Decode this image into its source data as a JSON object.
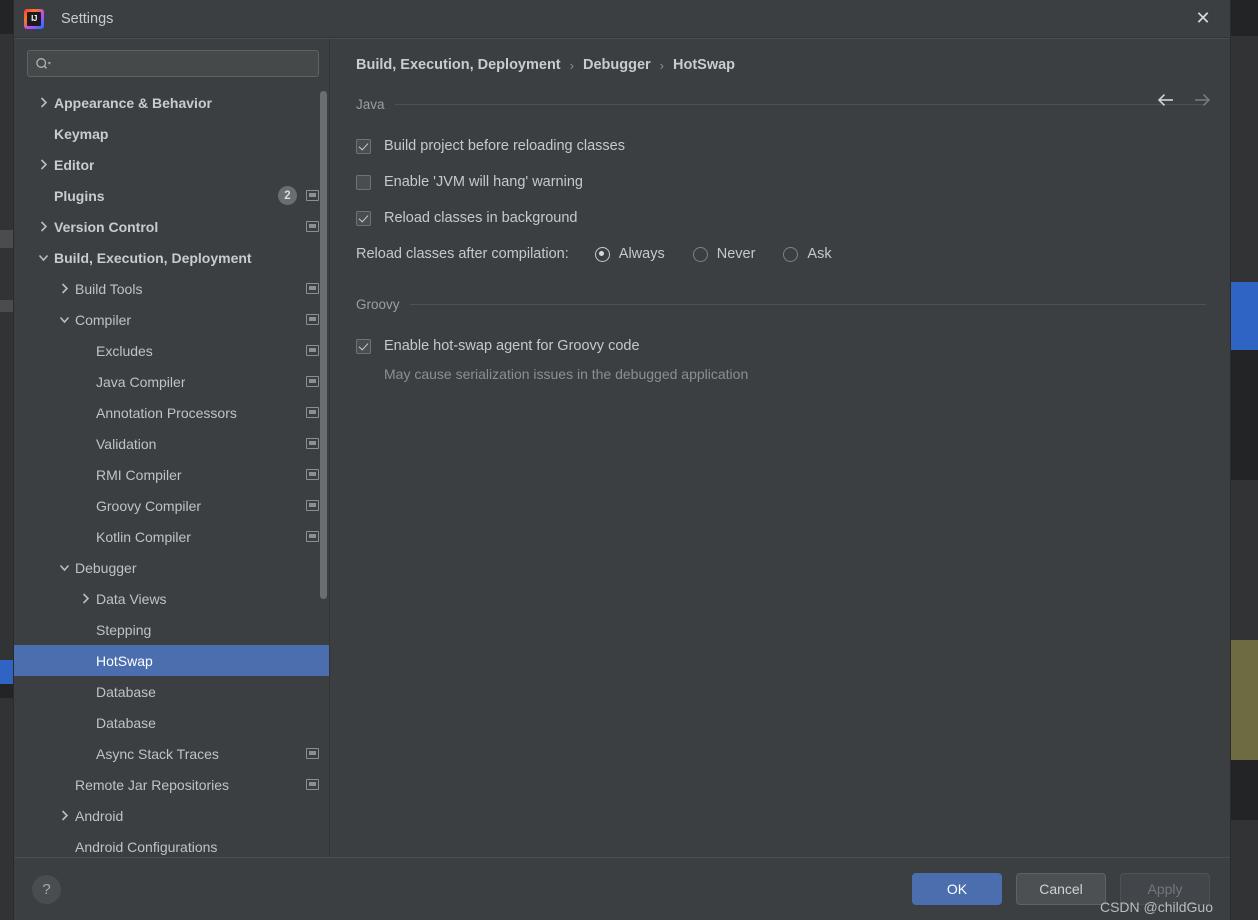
{
  "window": {
    "title": "Settings",
    "logo_icon": "intellij-idea-logo",
    "close_icon": "close-icon"
  },
  "search": {
    "placeholder": "",
    "value": "",
    "icon": "search-icon"
  },
  "sidebar": {
    "items": [
      {
        "label": "Appearance & Behavior",
        "twisty": "collapsed",
        "indent": 0,
        "bold": true,
        "badge": null,
        "project_icon": false,
        "selected": false
      },
      {
        "label": "Keymap",
        "twisty": "none",
        "indent": 0,
        "bold": true,
        "badge": null,
        "project_icon": false,
        "selected": false
      },
      {
        "label": "Editor",
        "twisty": "collapsed",
        "indent": 0,
        "bold": true,
        "badge": null,
        "project_icon": false,
        "selected": false
      },
      {
        "label": "Plugins",
        "twisty": "none",
        "indent": 0,
        "bold": true,
        "badge": "2",
        "project_icon": true,
        "selected": false
      },
      {
        "label": "Version Control",
        "twisty": "collapsed",
        "indent": 0,
        "bold": true,
        "badge": null,
        "project_icon": true,
        "selected": false
      },
      {
        "label": "Build, Execution, Deployment",
        "twisty": "expanded",
        "indent": 0,
        "bold": true,
        "badge": null,
        "project_icon": false,
        "selected": false
      },
      {
        "label": "Build Tools",
        "twisty": "collapsed",
        "indent": 1,
        "bold": false,
        "badge": null,
        "project_icon": true,
        "selected": false
      },
      {
        "label": "Compiler",
        "twisty": "expanded",
        "indent": 1,
        "bold": false,
        "badge": null,
        "project_icon": true,
        "selected": false
      },
      {
        "label": "Excludes",
        "twisty": "none",
        "indent": 2,
        "bold": false,
        "badge": null,
        "project_icon": true,
        "selected": false
      },
      {
        "label": "Java Compiler",
        "twisty": "none",
        "indent": 2,
        "bold": false,
        "badge": null,
        "project_icon": true,
        "selected": false
      },
      {
        "label": "Annotation Processors",
        "twisty": "none",
        "indent": 2,
        "bold": false,
        "badge": null,
        "project_icon": true,
        "selected": false
      },
      {
        "label": "Validation",
        "twisty": "none",
        "indent": 2,
        "bold": false,
        "badge": null,
        "project_icon": true,
        "selected": false
      },
      {
        "label": "RMI Compiler",
        "twisty": "none",
        "indent": 2,
        "bold": false,
        "badge": null,
        "project_icon": true,
        "selected": false
      },
      {
        "label": "Groovy Compiler",
        "twisty": "none",
        "indent": 2,
        "bold": false,
        "badge": null,
        "project_icon": true,
        "selected": false
      },
      {
        "label": "Kotlin Compiler",
        "twisty": "none",
        "indent": 2,
        "bold": false,
        "badge": null,
        "project_icon": true,
        "selected": false
      },
      {
        "label": "Debugger",
        "twisty": "expanded",
        "indent": 1,
        "bold": false,
        "badge": null,
        "project_icon": false,
        "selected": false
      },
      {
        "label": "Data Views",
        "twisty": "collapsed",
        "indent": 2,
        "bold": false,
        "badge": null,
        "project_icon": false,
        "selected": false
      },
      {
        "label": "Stepping",
        "twisty": "none",
        "indent": 2,
        "bold": false,
        "badge": null,
        "project_icon": false,
        "selected": false
      },
      {
        "label": "HotSwap",
        "twisty": "none",
        "indent": 2,
        "bold": false,
        "badge": null,
        "project_icon": false,
        "selected": true
      },
      {
        "label": "Database",
        "twisty": "none",
        "indent": 2,
        "bold": false,
        "badge": null,
        "project_icon": false,
        "selected": false
      },
      {
        "label": "Database",
        "twisty": "none",
        "indent": 2,
        "bold": false,
        "badge": null,
        "project_icon": false,
        "selected": false
      },
      {
        "label": "Async Stack Traces",
        "twisty": "none",
        "indent": 2,
        "bold": false,
        "badge": null,
        "project_icon": true,
        "selected": false
      },
      {
        "label": "Remote Jar Repositories",
        "twisty": "none",
        "indent": 1,
        "bold": false,
        "badge": null,
        "project_icon": true,
        "selected": false
      },
      {
        "label": "Android",
        "twisty": "collapsed",
        "indent": 1,
        "bold": false,
        "badge": null,
        "project_icon": false,
        "selected": false
      },
      {
        "label": "Android Configurations",
        "twisty": "none",
        "indent": 1,
        "bold": false,
        "badge": null,
        "project_icon": false,
        "selected": false
      }
    ]
  },
  "breadcrumb": {
    "crumbs": [
      "Build, Execution, Deployment",
      "Debugger",
      "HotSwap"
    ],
    "separator": "›",
    "back_icon": "arrow-left-icon",
    "forward_icon": "arrow-right-icon"
  },
  "main": {
    "java_section": {
      "title": "Java",
      "checkboxes": [
        {
          "label": "Build project before reloading classes",
          "checked": true
        },
        {
          "label": "Enable 'JVM will hang' warning",
          "checked": false
        },
        {
          "label": "Reload classes in background",
          "checked": true
        }
      ],
      "reload_row": {
        "label": "Reload classes after compilation:",
        "options": [
          {
            "label": "Always",
            "selected": true
          },
          {
            "label": "Never",
            "selected": false
          },
          {
            "label": "Ask",
            "selected": false
          }
        ]
      }
    },
    "groovy_section": {
      "title": "Groovy",
      "checkbox": {
        "label": "Enable hot-swap agent for Groovy code",
        "checked": true
      },
      "hint": "May cause serialization issues in the debugged application"
    }
  },
  "footer": {
    "help_label": "?",
    "help_icon": "help-icon",
    "ok_label": "OK",
    "cancel_label": "Cancel",
    "apply_label": "Apply",
    "apply_disabled": true
  },
  "watermark": {
    "text": "CSDN @childGuo"
  },
  "colors": {
    "dialog_bg": "#3c3f41",
    "selection_blue": "#4b6eaf",
    "text_primary": "#c5c9cd",
    "text_muted": "#8b8f93"
  }
}
